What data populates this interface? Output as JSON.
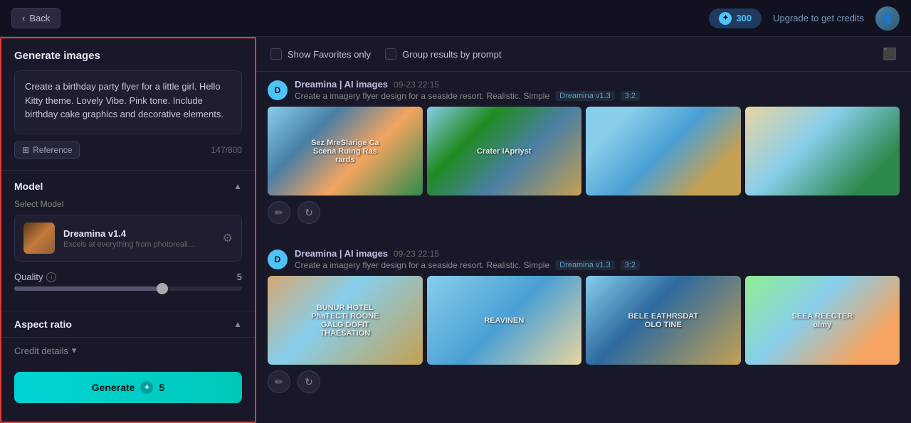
{
  "topbar": {
    "back_label": "Back",
    "credits": "300",
    "upgrade_label": "Upgrade to get credits"
  },
  "sidebar": {
    "title": "Generate images",
    "prompt_text": "Create a birthday party flyer for a little girl. Hello Kitty theme. Lovely Vibe. Pink tone. Include birthday cake graphics and decorative elements.",
    "reference_label": "Reference",
    "char_count": "147/800",
    "model_section_title": "Model",
    "select_model_label": "Select Model",
    "model_name": "Dreamina v1.4",
    "model_desc": "Excels at everything from photoreali...",
    "quality_label": "Quality",
    "quality_value": "5",
    "aspect_ratio_label": "Aspect ratio",
    "credit_details_label": "Credit details",
    "generate_label": "Generate",
    "generate_cost": "5"
  },
  "filter_bar": {
    "favorites_label": "Show Favorites only",
    "group_label": "Group results by prompt"
  },
  "groups": [
    {
      "avatar": "D",
      "name": "Dreamina | AI images",
      "time": "09-23  22:15",
      "prompt": "Create a imagery flyer design for a seaside resort.  Realistic. Simple",
      "model": "Dreamina v1.3",
      "ratio": "3:2",
      "images": [
        {
          "class": "img-beach1",
          "text": "Sez MreSlarige\nCa Scena Ruing Ras rards"
        },
        {
          "class": "img-beach2",
          "text": "Crater IApriyst"
        },
        {
          "class": "img-beach3",
          "text": ""
        },
        {
          "class": "img-beach4",
          "text": ""
        }
      ]
    },
    {
      "avatar": "D",
      "name": "Dreamina | AI images",
      "time": "09-23  22:15",
      "prompt": "Create a imagery flyer design for a seaside resort.  Realistic. Simple",
      "model": "Dreamina v1.3",
      "ratio": "3:2",
      "images": [
        {
          "class": "img-resort1",
          "text": "BUNUR HOTEL\nPhaTECTI\nROONE\nGALG\nDOFIT THAESATION"
        },
        {
          "class": "img-resort2",
          "text": "REAVINEN"
        },
        {
          "class": "img-resort3",
          "text": "BELE\nEATHRSDAT\nOLO TINE"
        },
        {
          "class": "img-resort4",
          "text": "SEEA REEGTER\nolmy"
        }
      ]
    }
  ]
}
